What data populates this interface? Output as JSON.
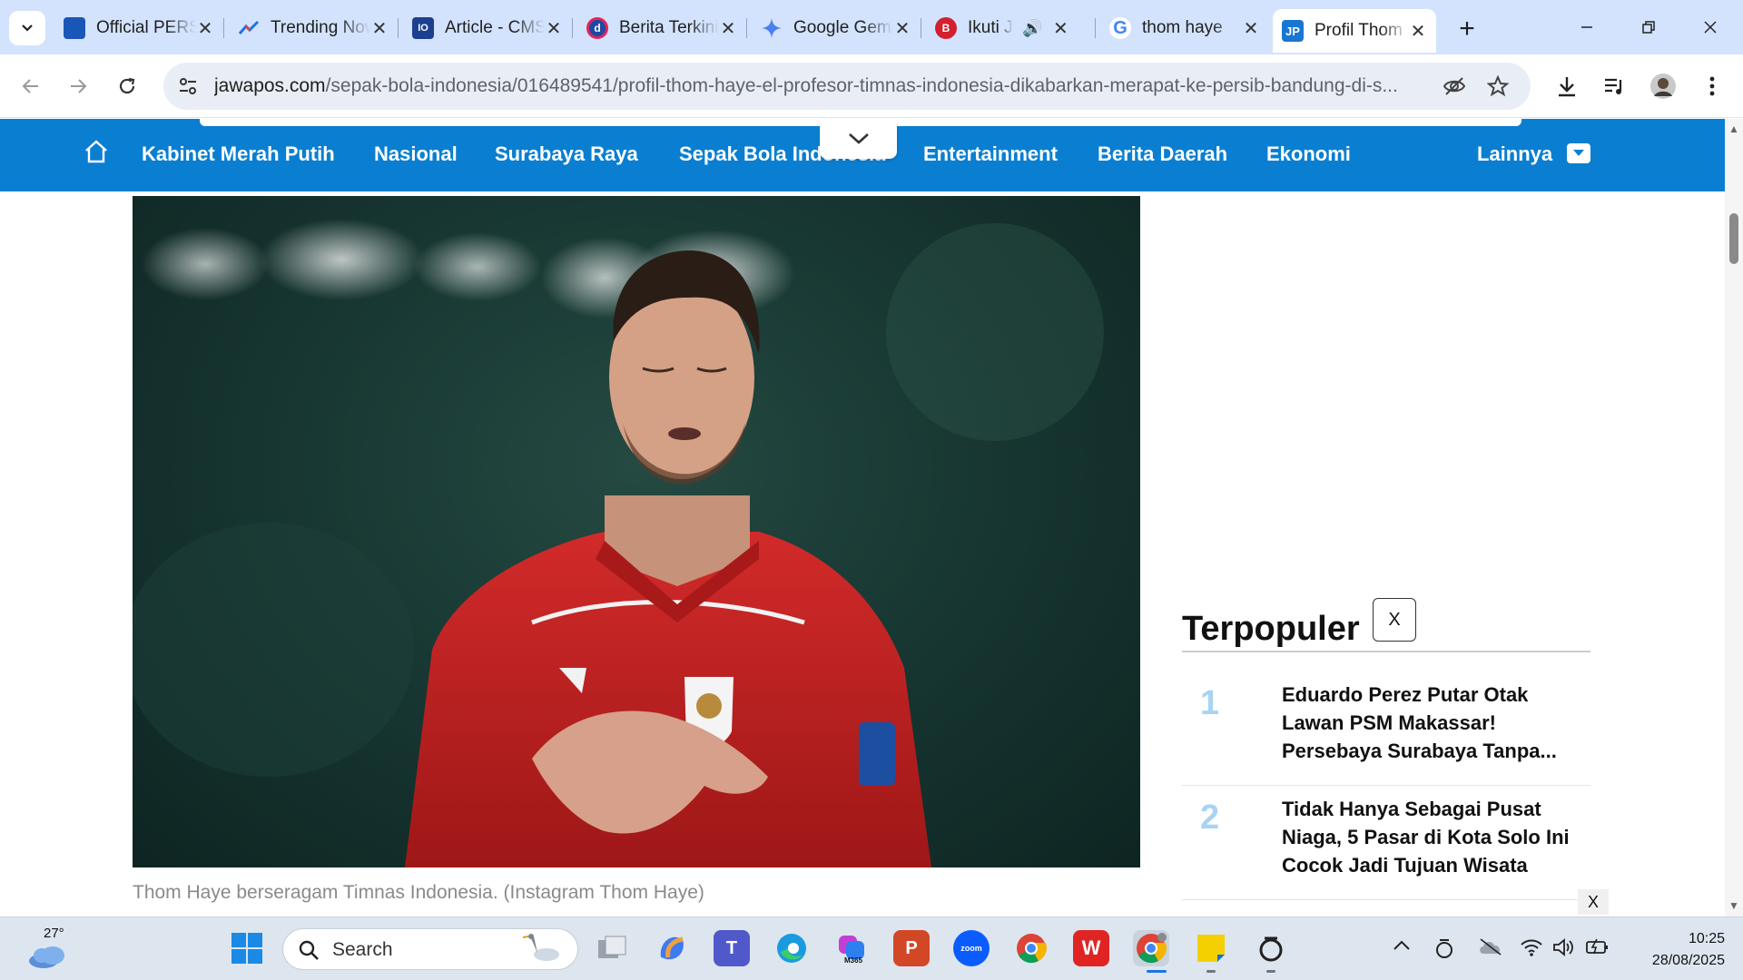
{
  "browser": {
    "tabs": [
      {
        "title": "Official PERSIB",
        "favicon": "persib-icon",
        "color": "#1a56b8"
      },
      {
        "title": "Trending Now",
        "favicon": "trending-icon",
        "color": "#1a73e8"
      },
      {
        "title": "Article - CMS",
        "favicon": "cms-icon",
        "color": "#1d3f8f"
      },
      {
        "title": "Berita Terkini",
        "favicon": "detik-icon",
        "color": "#1d4aa1"
      },
      {
        "title": "Google Gemini",
        "favicon": "gemini-icon",
        "color": "#4a7ef5"
      },
      {
        "title": "Ikuti Jejak",
        "favicon": "b-icon",
        "color": "#d3202e"
      },
      {
        "title": "thom haye",
        "favicon": "google-icon",
        "color": "#4285f4"
      },
      {
        "title": "Profil Thom Haye",
        "favicon": "jp-icon",
        "color": "#1976d2",
        "active": true
      }
    ],
    "url_domain": "jawapos.com",
    "url_path": "/sepak-bola-indonesia/016489541/profil-thom-haye-el-profesor-timnas-indonesia-dikabarkan-merapat-ke-persib-bandung-di-s..."
  },
  "site": {
    "nav": [
      "Kabinet Merah Putih",
      "Nasional",
      "Surabaya Raya",
      "Sepak Bola Indonesia",
      "Entertainment",
      "Berita Daerah",
      "Ekonomi"
    ],
    "more_label": "Lainnya",
    "brand_color": "#0a7fd1"
  },
  "article": {
    "image_caption": "Thom Haye berseragam Timnas Indonesia. (Instagram Thom Haye)"
  },
  "sidebar": {
    "title": "Terpopuler",
    "close_label": "X",
    "items": [
      {
        "rank": "1",
        "title": "Eduardo Perez Putar Otak Lawan PSM Makassar! Persebaya Surabaya Tanpa..."
      },
      {
        "rank": "2",
        "title": "Tidak Hanya Sebagai Pusat Niaga, 5 Pasar di Kota Solo Ini Cocok Jadi Tujuan Wisata"
      }
    ],
    "ad_close_label": "X"
  },
  "taskbar": {
    "temperature": "27°",
    "search_placeholder": "Search",
    "time": "10:25",
    "date": "28/08/2025"
  }
}
